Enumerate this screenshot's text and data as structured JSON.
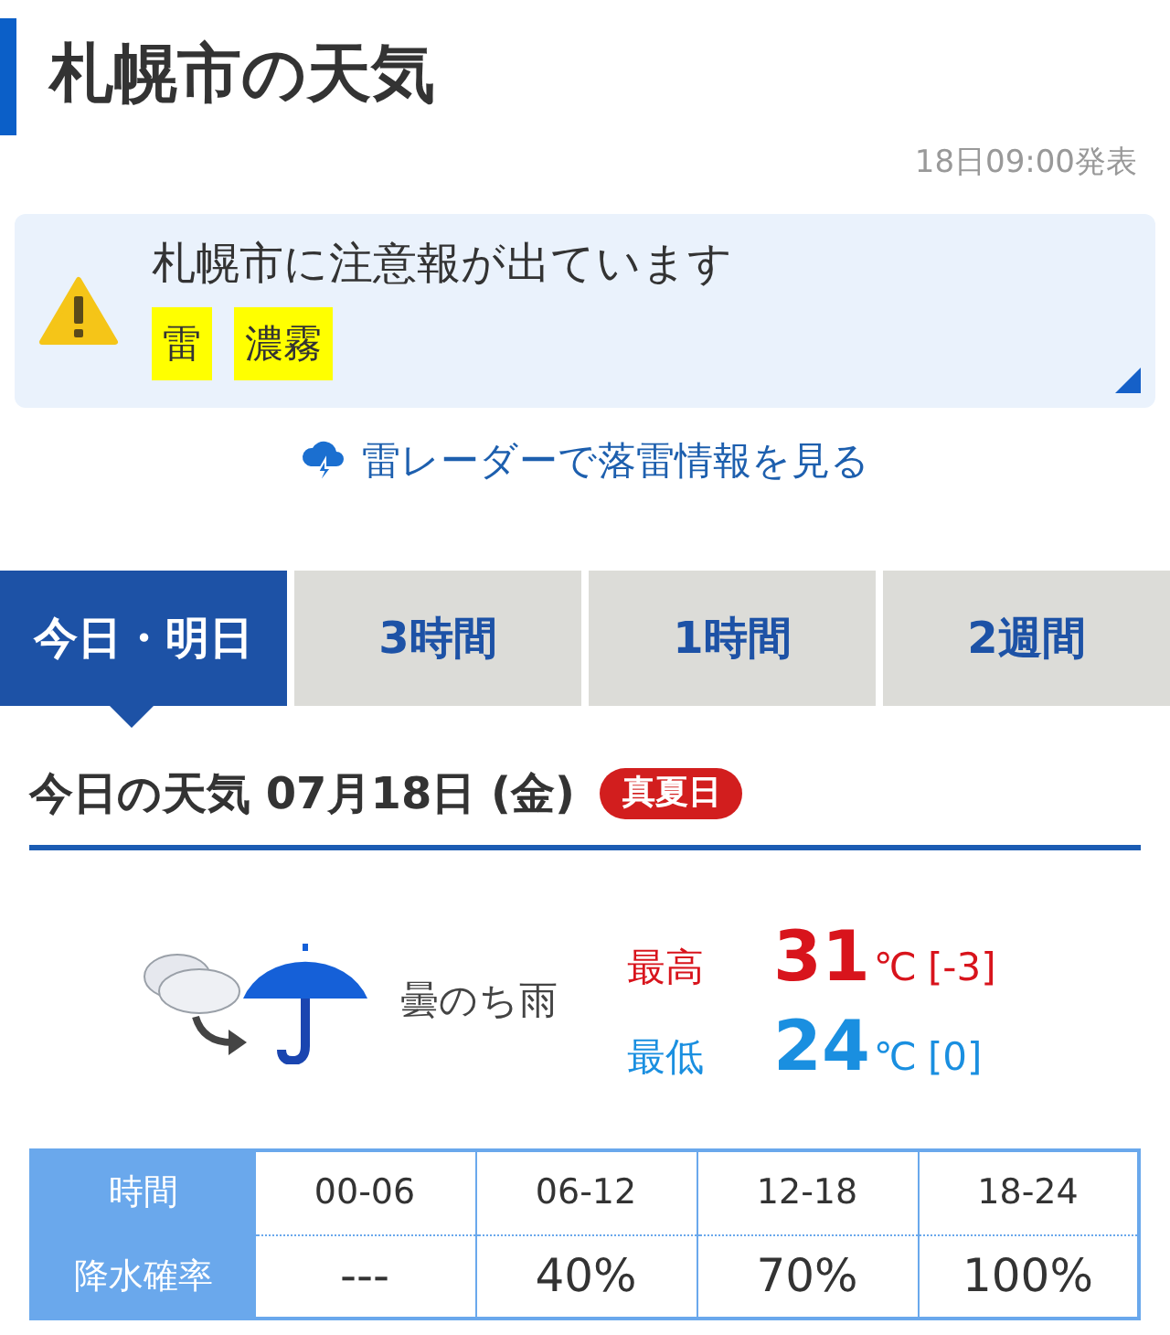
{
  "title": "札幌市の天気",
  "issued": "18日09:00発表",
  "alert": {
    "message": "札幌市に注意報が出ています",
    "warnings": [
      "雷",
      "濃霧"
    ]
  },
  "radar_link": "雷レーダーで落雷情報を見る",
  "tabs": [
    {
      "label": "今日・明日",
      "selected": true
    },
    {
      "label": "3時間",
      "selected": false
    },
    {
      "label": "1時間",
      "selected": false
    },
    {
      "label": "2週間",
      "selected": false
    }
  ],
  "today": {
    "heading": "今日の天気 07月18日 (金)",
    "badge": "真夏日",
    "condition": "曇のち雨",
    "temps": [
      {
        "kind": "high",
        "label": "最高",
        "value": "31",
        "unit": "℃",
        "diff": "[-3]"
      },
      {
        "kind": "low",
        "label": "最低",
        "value": "24",
        "unit": "℃",
        "diff": "[0]"
      }
    ]
  },
  "precip_table": {
    "header_row": {
      "label": "時間",
      "cells": [
        "00-06",
        "06-12",
        "12-18",
        "18-24"
      ]
    },
    "value_row": {
      "label": "降水確率",
      "cells": [
        "---",
        "40%",
        "70%",
        "100%"
      ]
    }
  }
}
